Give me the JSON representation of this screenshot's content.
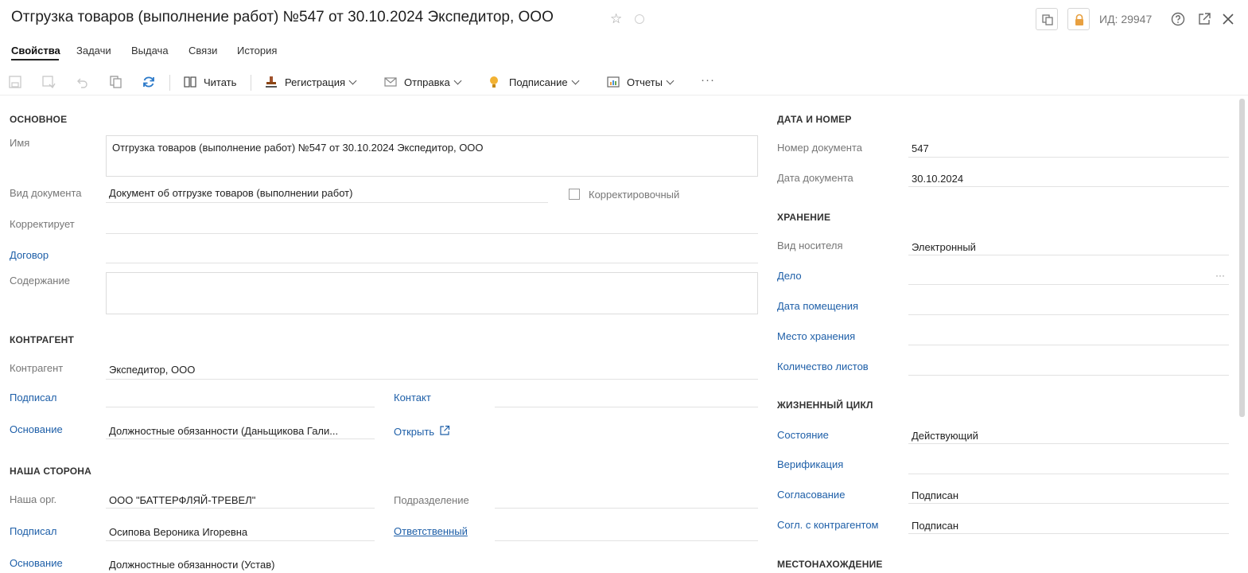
{
  "window": {
    "title": "Отгрузка товаров (выполнение работ) №547 от 30.10.2024 Экспедитор, ООО",
    "id_label": "ИД: 29947"
  },
  "tabs": [
    {
      "label": "Свойства",
      "active": true
    },
    {
      "label": "Задачи"
    },
    {
      "label": "Выдача"
    },
    {
      "label": "Связи"
    },
    {
      "label": "История"
    }
  ],
  "toolbar": {
    "read": "Читать",
    "registration": "Регистрация",
    "send": "Отправка",
    "signing": "Подписание",
    "reports": "Отчеты",
    "more": "···"
  },
  "main": {
    "section": "ОСНОВНОЕ",
    "name_label": "Имя",
    "name_value": "Отгрузка товаров (выполнение работ) №547 от 30.10.2024 Экспедитор, ООО",
    "doc_kind_label": "Вид документа",
    "doc_kind_value": "Документ об отгрузке товаров (выполнении работ)",
    "corrective_label": "Корректировочный",
    "corrects_label": "Корректирует",
    "contract_label": "Договор",
    "content_label": "Содержание"
  },
  "counterparty": {
    "section": "КОНТРАГЕНТ",
    "cp_label": "Контрагент",
    "cp_value": "Экспедитор, ООО",
    "signed_label": "Подписал",
    "contact_label": "Контакт",
    "basis_label": "Основание",
    "basis_value": "Должностные обязанности (Даньщикова Гали...",
    "open_link": "Открыть"
  },
  "our_side": {
    "section": "НАША СТОРОНА",
    "org_label": "Наша орг.",
    "org_value": "ООО \"БАТТЕРФЛЯЙ-ТРЕВЕЛ\"",
    "dept_label": "Подразделение",
    "signed_label": "Подписал",
    "signed_value": "Осипова Вероника Игоревна",
    "responsible_label": "Ответственный",
    "basis_label": "Основание",
    "basis_value": "Должностные обязанности (Устав)"
  },
  "date_number": {
    "section": "ДАТА И НОМЕР",
    "number_label": "Номер документа",
    "number_value": "547",
    "date_label": "Дата документа",
    "date_value": "30.10.2024"
  },
  "storage": {
    "section": "ХРАНЕНИЕ",
    "media_label": "Вид носителя",
    "media_value": "Электронный",
    "case_label": "Дело",
    "case_more": "···",
    "placed_label": "Дата помещения",
    "place_label": "Место хранения",
    "sheets_label": "Количество листов"
  },
  "lifecycle": {
    "section": "ЖИЗНЕННЫЙ ЦИКЛ",
    "state_label": "Состояние",
    "state_value": "Действующий",
    "verification_label": "Верификация",
    "approval_label": "Согласование",
    "approval_value": "Подписан",
    "cp_approval_label": "Согл. с контрагентом",
    "cp_approval_value": "Подписан"
  },
  "location": {
    "section": "МЕСТОНАХОЖДЕНИЕ"
  },
  "colors": {
    "link_blue": "#1e5fa8",
    "refresh_blue": "#2b79c9",
    "lock_orange": "#e8a040",
    "sign_yellow": "#f2b233"
  }
}
